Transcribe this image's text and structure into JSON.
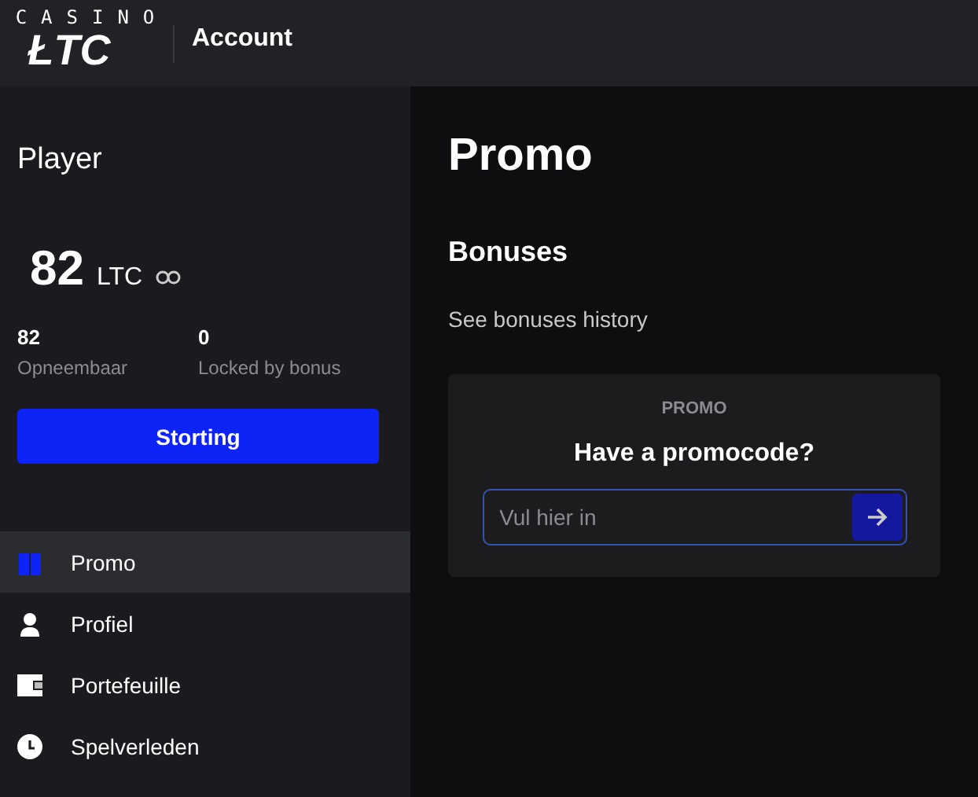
{
  "logo": {
    "top": "CASINO",
    "main": "ŁTC"
  },
  "header": {
    "title": "Account"
  },
  "sidebar": {
    "player": "Player",
    "balance": {
      "amount": "82",
      "currency": "LTC"
    },
    "stats": [
      {
        "value": "82",
        "label": "Opneembaar"
      },
      {
        "value": "0",
        "label": "Locked by bonus"
      }
    ],
    "deposit_button": "Storting",
    "items": [
      {
        "label": "Promo",
        "kind": "promo",
        "selected": true
      },
      {
        "label": "Profiel",
        "kind": "profile",
        "selected": false
      },
      {
        "label": "Portefeuille",
        "kind": "wallet",
        "selected": false
      },
      {
        "label": "Spelverleden",
        "kind": "history",
        "selected": false
      }
    ]
  },
  "main": {
    "title": "Promo",
    "section": "Bonuses",
    "history_link": "See bonuses history",
    "card": {
      "eyebrow": "PROMO",
      "heading": "Have a promocode?",
      "placeholder": "Vul hier in"
    }
  }
}
